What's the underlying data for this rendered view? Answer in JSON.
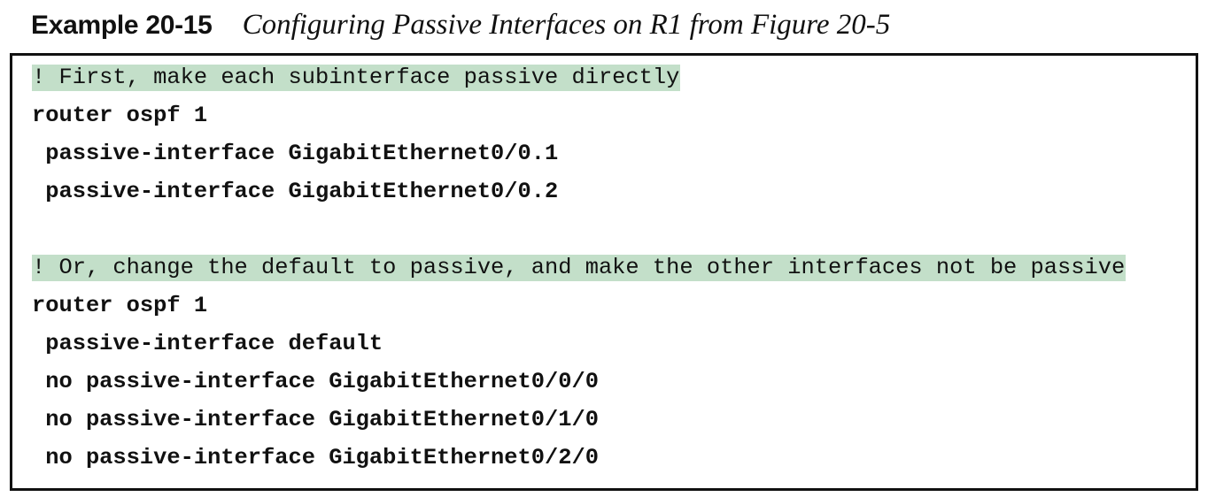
{
  "example": {
    "label": "Example 20-15",
    "title": "Configuring Passive Interfaces on R1 from Figure 20-5"
  },
  "code": {
    "lines": [
      {
        "text": "! First, make each subinterface passive directly",
        "kind": "comment"
      },
      {
        "text": "router ospf 1",
        "kind": "cmd"
      },
      {
        "text": " passive-interface GigabitEthernet0/0.1",
        "kind": "cmd"
      },
      {
        "text": " passive-interface GigabitEthernet0/0.2",
        "kind": "cmd"
      },
      {
        "text": "",
        "kind": "blank"
      },
      {
        "text": "! Or, change the default to passive, and make the other interfaces not be passive",
        "kind": "comment"
      },
      {
        "text": "router ospf 1",
        "kind": "cmd"
      },
      {
        "text": " passive-interface default",
        "kind": "cmd"
      },
      {
        "text": " no passive-interface GigabitEthernet0/0/0",
        "kind": "cmd"
      },
      {
        "text": " no passive-interface GigabitEthernet0/1/0",
        "kind": "cmd"
      },
      {
        "text": " no passive-interface GigabitEthernet0/2/0",
        "kind": "cmd"
      }
    ]
  },
  "colors": {
    "comment_highlight": "#c3dfc9",
    "text": "#111111",
    "border": "#111111"
  }
}
